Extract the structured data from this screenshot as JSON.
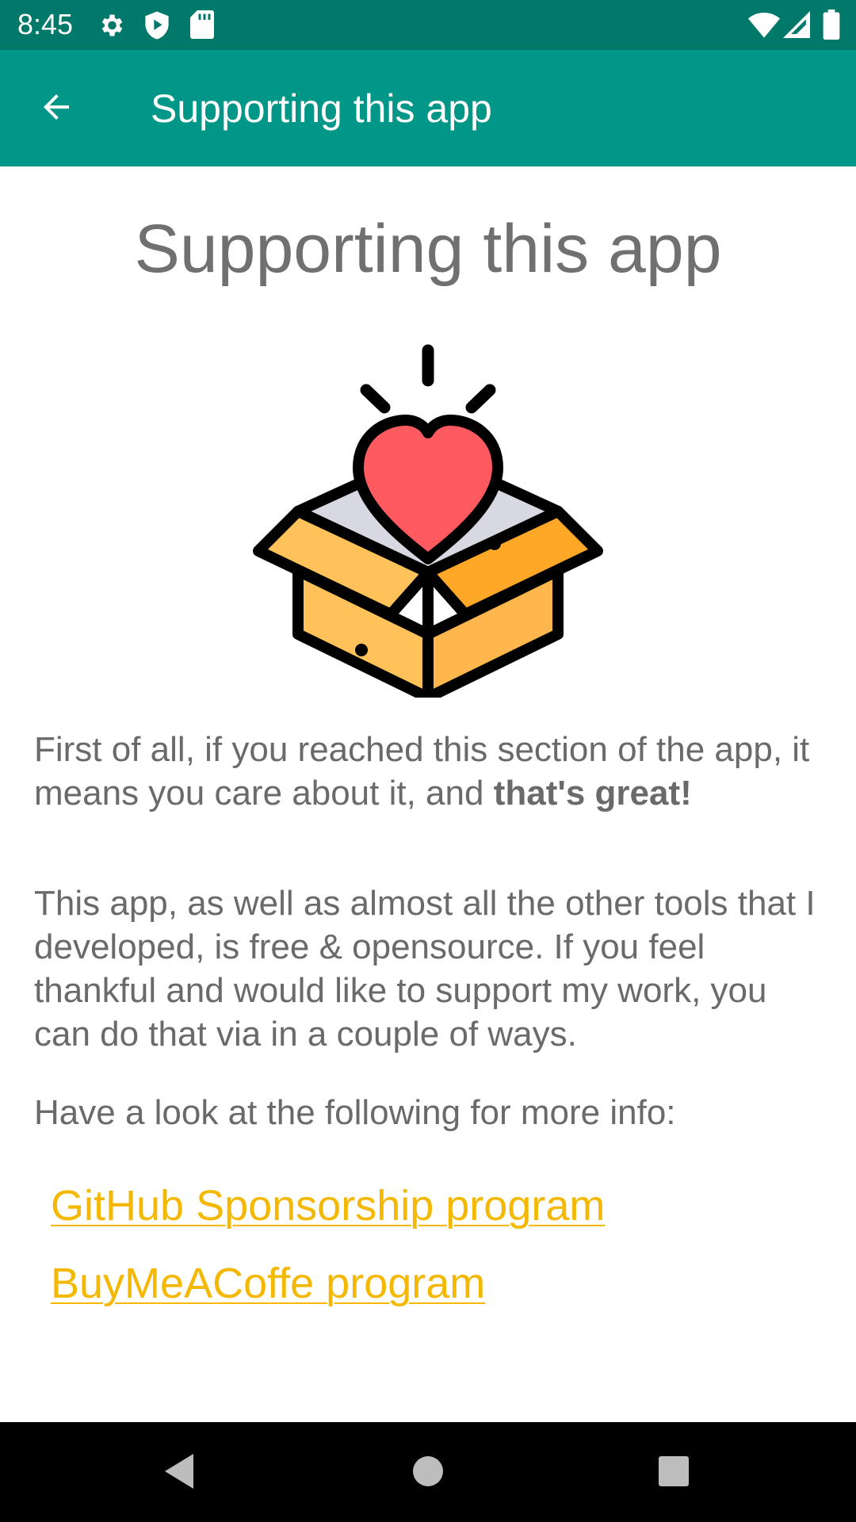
{
  "status_bar": {
    "time": "8:45",
    "icons": [
      "settings-gear-icon",
      "shield-play-icon",
      "sd-card-icon",
      "wifi-icon",
      "cell-signal-icon",
      "battery-icon"
    ]
  },
  "app_bar": {
    "title": "Supporting this app",
    "back_icon": "arrow-back-icon",
    "color": "#009688",
    "status_color": "#00796b"
  },
  "content": {
    "heading": "Supporting this app",
    "illustration": "gift-box-heart-icon",
    "paragraph1": {
      "text": "First of all, if you reached this section of the app, it means you care about it, and ",
      "bold": "that's great!"
    },
    "paragraph2": "This app, as well as almost all the other tools that I developed, is free & opensource. If you feel thankful and would like to support my work, you can do that via in a couple of ways.",
    "paragraph3": "Have a look at the following for more info:",
    "links": [
      {
        "label": "GitHub Sponsorship program"
      },
      {
        "label": "BuyMeACoffe program"
      }
    ],
    "link_color": "#f5b800",
    "text_color": "#6a6a6a"
  },
  "nav_bar": {
    "buttons": [
      "back-triangle-icon",
      "home-circle-icon",
      "recents-square-icon"
    ]
  }
}
